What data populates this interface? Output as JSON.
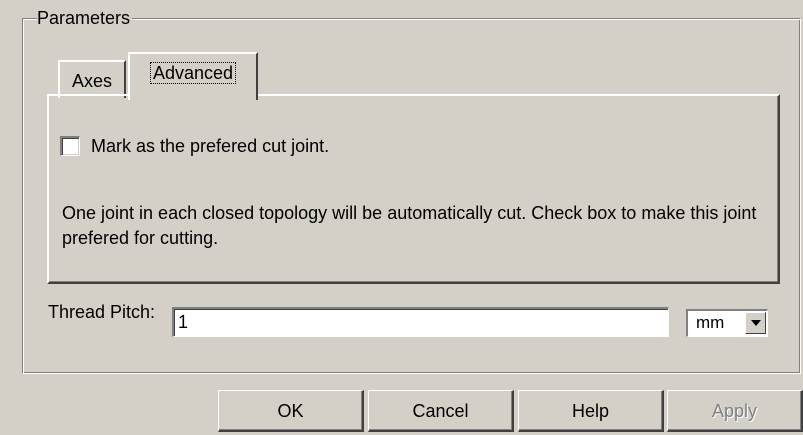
{
  "group": {
    "title": "Parameters"
  },
  "tabs": [
    {
      "label": "Axes",
      "active": false
    },
    {
      "label": "Advanced",
      "active": true
    }
  ],
  "advanced": {
    "checkbox_label": "Mark as the prefered cut joint.",
    "checkbox_checked": false,
    "description": "One joint in each closed topology will be automatically cut. Check box to make this joint prefered for cutting."
  },
  "thread_pitch": {
    "label": "Thread Pitch:",
    "value": "1",
    "unit": "mm"
  },
  "buttons": {
    "ok": "OK",
    "cancel": "Cancel",
    "help": "Help",
    "apply": "Apply",
    "apply_enabled": false
  },
  "icons": {
    "dropdown": "chevron-down-icon"
  }
}
